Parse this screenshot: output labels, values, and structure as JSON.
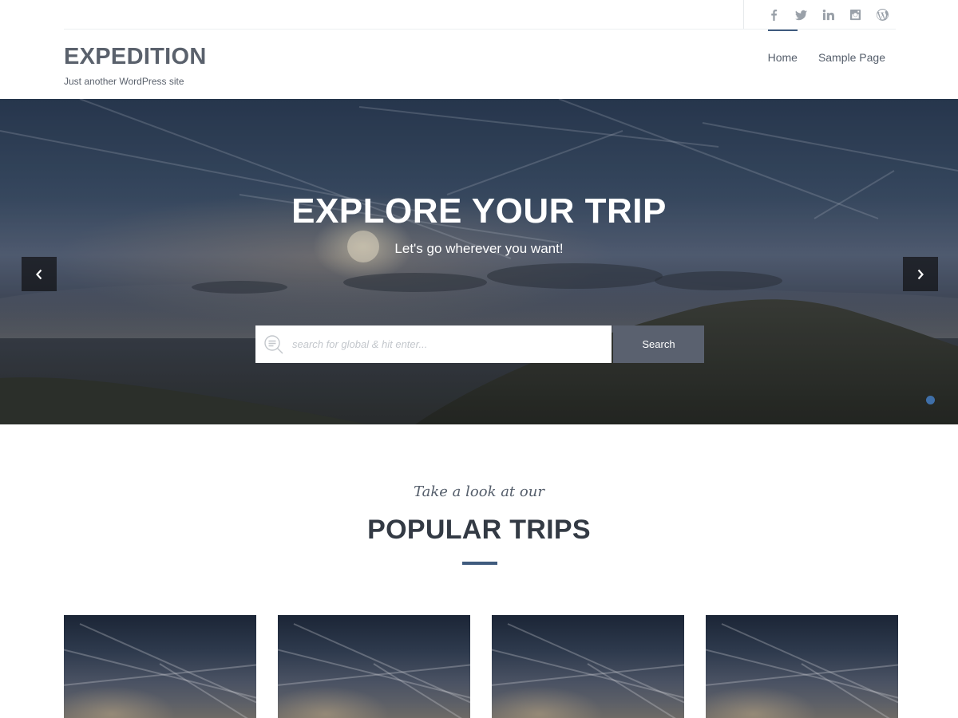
{
  "social": {
    "icons": [
      "facebook-icon",
      "twitter-icon",
      "linkedin-icon",
      "instagram-icon",
      "wordpress-icon"
    ],
    "glyphs": [
      "f",
      "",
      "in",
      "",
      ""
    ]
  },
  "header": {
    "title": "EXPEDITION",
    "tagline": "Just another WordPress site",
    "nav": [
      {
        "label": "Home",
        "active": true
      },
      {
        "label": "Sample Page",
        "active": false
      }
    ]
  },
  "hero": {
    "title": "EXPLORE YOUR TRIP",
    "subtitle": "Let's go wherever you want!",
    "search_placeholder": "search for global & hit enter...",
    "search_button": "Search",
    "accent": "#3f6fa8"
  },
  "section": {
    "kicker": "Take a look at our",
    "title": "POPULAR TRIPS",
    "accent": "#3f5b7e"
  },
  "cards_count_visible": 4
}
